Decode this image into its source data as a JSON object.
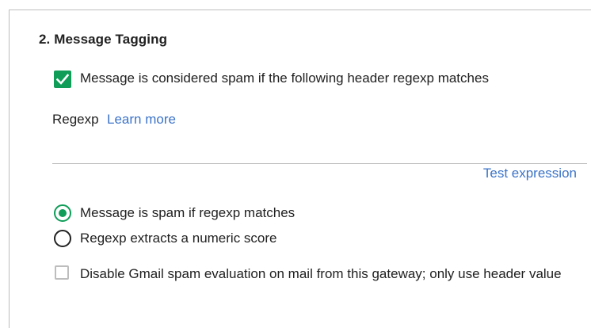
{
  "section": {
    "title": "2. Message Tagging"
  },
  "spam_header_check": {
    "label": "Message is considered spam if the following header regexp matches",
    "checked": true
  },
  "regexp": {
    "label": "Regexp",
    "learn_more": "Learn more",
    "value": "",
    "test_label": "Test expression"
  },
  "match_mode": {
    "options": [
      {
        "label": "Message is spam if regexp matches",
        "selected": true
      },
      {
        "label": "Regexp extracts a numeric score",
        "selected": false
      }
    ]
  },
  "disable_gmail_eval": {
    "label": "Disable Gmail spam evaluation on mail from this gateway; only use header value",
    "checked": false
  },
  "colors": {
    "accent_green": "#0f9d58",
    "link_blue": "#3b73c8",
    "border_gray": "#bdbdbd",
    "text": "#212121"
  }
}
